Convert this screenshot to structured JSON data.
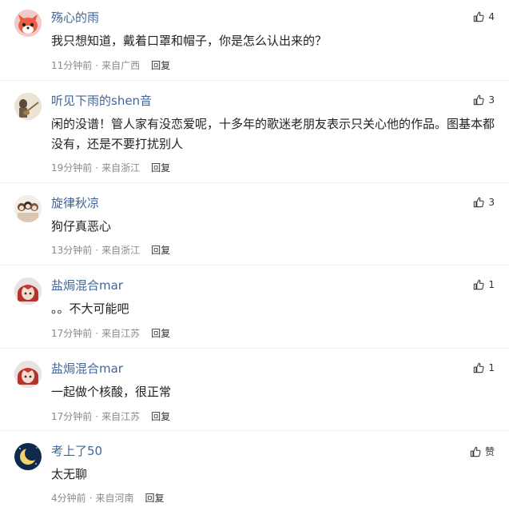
{
  "comments": [
    {
      "username": "殇心的雨",
      "content": "我只想知道，戴着口罩和帽子，你是怎么认出来的？",
      "time": "11分钟前",
      "location": "来自广西",
      "reply_label": "回复",
      "likes": "4",
      "avatar_icon": "fox-avatar-icon"
    },
    {
      "username": "听见下雨的shen音",
      "content": "闲的没谱！管人家有没恋爱呢，十多年的歌迷老朋友表示只关心他的作品。图基本都没有，还是不要打扰别人",
      "time": "19分钟前",
      "location": "来自浙江",
      "reply_label": "回复",
      "likes": "3",
      "avatar_icon": "guitar-player-avatar-icon"
    },
    {
      "username": "旋律秋凉",
      "content": "狗仔真恶心",
      "time": "13分钟前",
      "location": "来自浙江",
      "reply_label": "回复",
      "likes": "3",
      "avatar_icon": "group-girls-avatar-icon"
    },
    {
      "username": "盐焗混合mar",
      "content": "。。不大可能吧",
      "time": "17分钟前",
      "location": "来自江苏",
      "reply_label": "回复",
      "likes": "1",
      "avatar_icon": "red-hair-anime-avatar-icon"
    },
    {
      "username": "盐焗混合mar",
      "content": "一起做个核酸，很正常",
      "time": "17分钟前",
      "location": "来自江苏",
      "reply_label": "回复",
      "likes": "1",
      "avatar_icon": "red-hair-anime-avatar-icon"
    },
    {
      "username": "考上了50",
      "content": "太无聊",
      "time": "4分钟前",
      "location": "来自河南",
      "reply_label": "回复",
      "likes": "赞",
      "avatar_icon": "moon-night-avatar-icon"
    }
  ],
  "colors": {
    "username": "#406599",
    "meta": "#8a8a8a",
    "content": "#222222"
  }
}
